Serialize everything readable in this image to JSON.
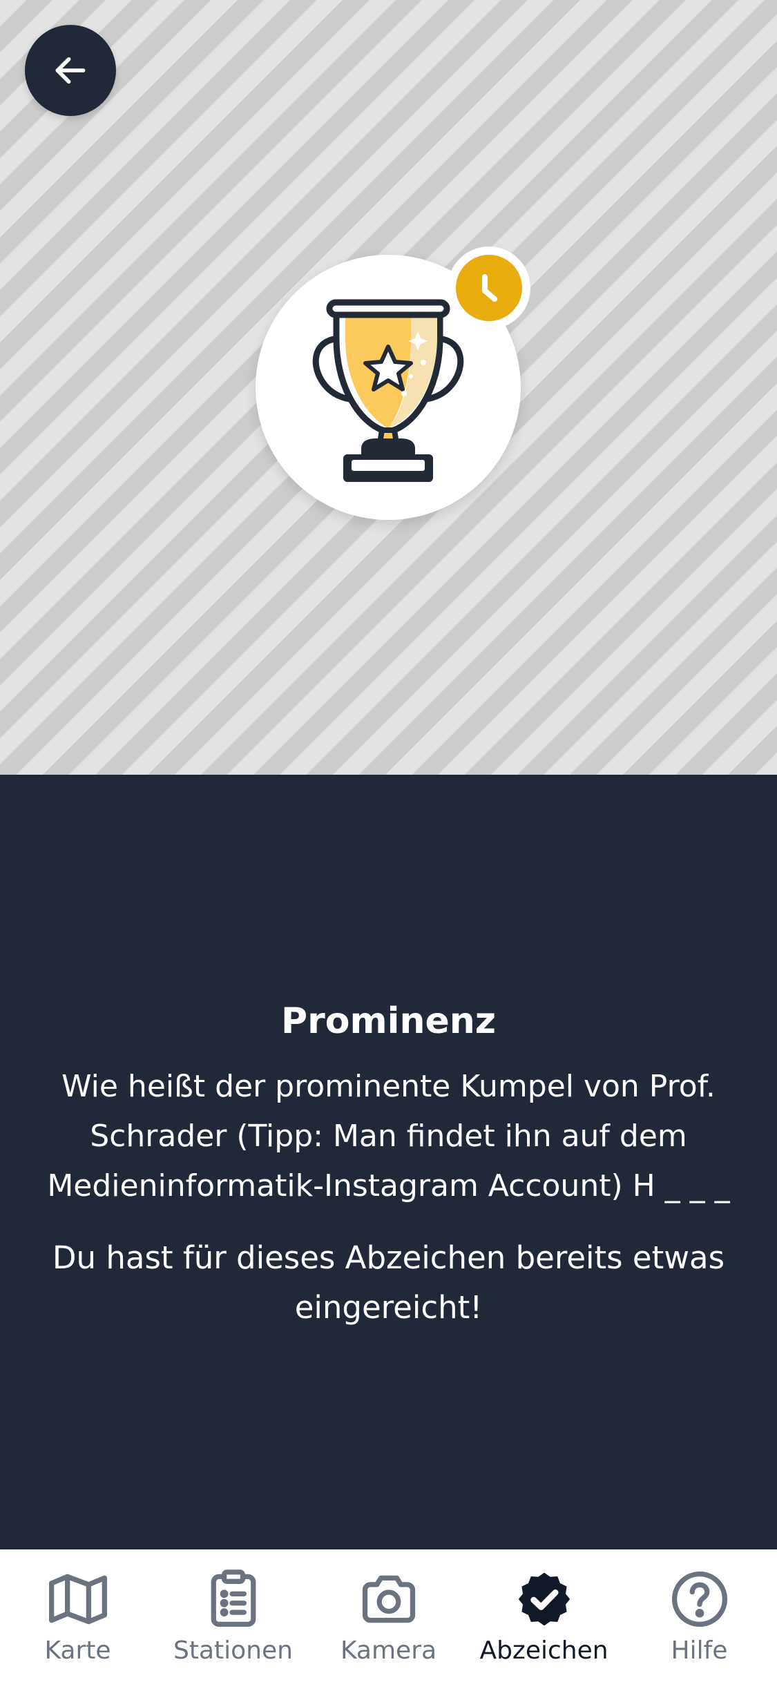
{
  "header": {
    "back_icon": "arrow-left-icon"
  },
  "badge": {
    "icon": "trophy-icon",
    "status_icon": "clock-icon",
    "accent_color": "#e8ac0f"
  },
  "content": {
    "title": "Prominenz",
    "question": "Wie heißt der prominente Kumpel von Prof. Schrader (Tipp: Man findet ihn auf dem Medieninformatik-Instagram Account) H _ _ _",
    "status": "Du hast für dieses Abzeichen bereits etwas eingereicht!"
  },
  "tabbar": {
    "tabs": [
      {
        "label": "Karte",
        "icon": "map-icon",
        "active": false
      },
      {
        "label": "Stationen",
        "icon": "clipboard-list-icon",
        "active": false
      },
      {
        "label": "Kamera",
        "icon": "camera-icon",
        "active": false
      },
      {
        "label": "Abzeichen",
        "icon": "badge-check-icon",
        "active": true
      },
      {
        "label": "Hilfe",
        "icon": "question-circle-icon",
        "active": false
      }
    ]
  },
  "colors": {
    "dark_bg": "#212938",
    "inactive_tab": "#6b7280",
    "active_tab": "#111827"
  }
}
